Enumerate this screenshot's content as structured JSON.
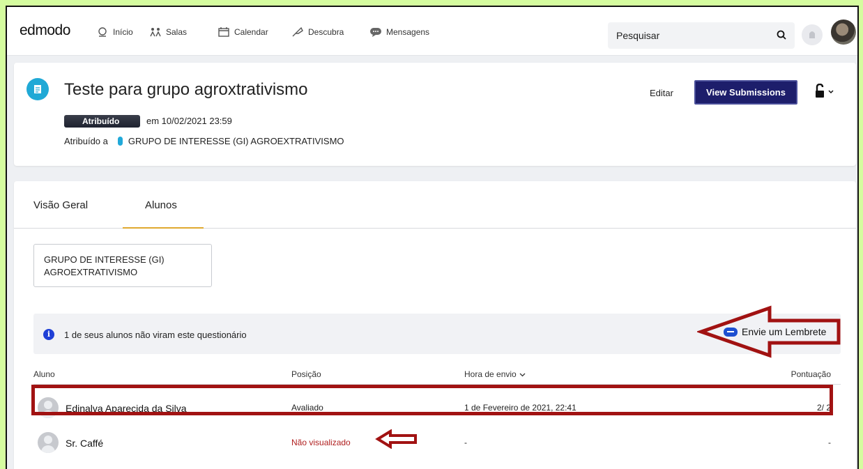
{
  "topbar": {
    "logo": "edmodo",
    "nav": [
      {
        "label": "Início",
        "icon": "home-icon"
      },
      {
        "label": "Salas",
        "icon": "classes-icon"
      },
      {
        "label": "Calendar",
        "icon": "calendar-icon"
      },
      {
        "label": "Descubra",
        "icon": "discover-icon"
      },
      {
        "label": "Mensagens",
        "icon": "messages-icon"
      }
    ],
    "search_placeholder": "Pesquisar"
  },
  "assignment": {
    "title": "Teste para grupo agroxtrativismo",
    "status_badge": "Atribuído",
    "due": "em 10/02/2021 23:59",
    "assigned_to_label": "Atribuído a",
    "assigned_group": "GRUPO DE INTERESSE (GI) AGROEXTRATIVISMO",
    "edit_label": "Editar",
    "view_submissions_label": "View Submissions"
  },
  "tabs": [
    {
      "label": "Visão Geral"
    },
    {
      "label": "Alunos"
    }
  ],
  "group_selector": {
    "line1": "GRUPO DE INTERESSE (GI)",
    "line2": "AGROEXTRATIVISMO"
  },
  "notice": {
    "text": "1 de seus alunos não viram este questionário",
    "reminder_label": "Envie um Lembrete"
  },
  "table": {
    "headers": {
      "student": "Aluno",
      "position": "Posição",
      "sent_time": "Hora de envio",
      "score": "Pontuação"
    },
    "rows": [
      {
        "name": "Edinalva Aparecida da Silva",
        "position": "Avaliado",
        "sent_time": "1 de Fevereiro de 2021, 22:41",
        "score": "2/ 2"
      },
      {
        "name": "Sr. Caffé",
        "position": "Não visualizado",
        "sent_time": "-",
        "score": "-"
      }
    ]
  },
  "colors": {
    "page_background": "#d5fc9f",
    "annotation": "#a11212",
    "primary_button": "#1d1e6b",
    "tab_underline": "#e0a92f"
  }
}
